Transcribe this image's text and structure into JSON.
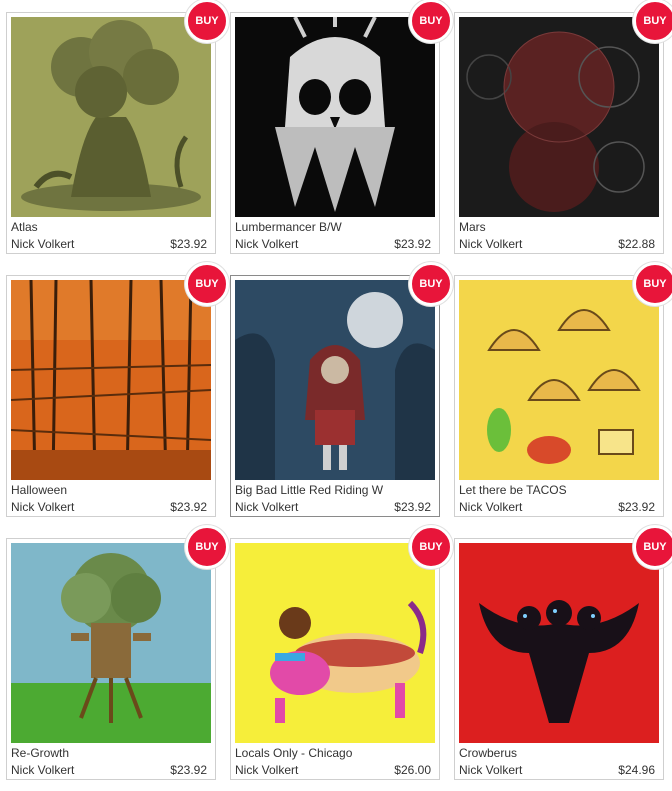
{
  "products": [
    {
      "title": "Atlas",
      "artist": "Nick Volkert",
      "price": "$23.92",
      "buy_label": "BUY"
    },
    {
      "title": "Lumbermancer B/W",
      "artist": "Nick Volkert",
      "price": "$23.92",
      "buy_label": "BUY"
    },
    {
      "title": "Mars",
      "artist": "Nick Volkert",
      "price": "$22.88",
      "buy_label": "BUY"
    },
    {
      "title": "Halloween",
      "artist": "Nick Volkert",
      "price": "$23.92",
      "buy_label": "BUY"
    },
    {
      "title": "Big Bad Little Red Riding W",
      "artist": "Nick Volkert",
      "price": "$23.92",
      "buy_label": "BUY"
    },
    {
      "title": "Let there be TACOS",
      "artist": "Nick Volkert",
      "price": "$23.92",
      "buy_label": "BUY"
    },
    {
      "title": "Re-Growth",
      "artist": "Nick Volkert",
      "price": "$23.92",
      "buy_label": "BUY"
    },
    {
      "title": "Locals Only - Chicago",
      "artist": "Nick Volkert",
      "price": "$26.00",
      "buy_label": "BUY"
    },
    {
      "title": "Crowberus",
      "artist": "Nick Volkert",
      "price": "$24.96",
      "buy_label": "BUY"
    }
  ],
  "colors": {
    "buy_badge": "#e8153a",
    "text": "#333333"
  }
}
